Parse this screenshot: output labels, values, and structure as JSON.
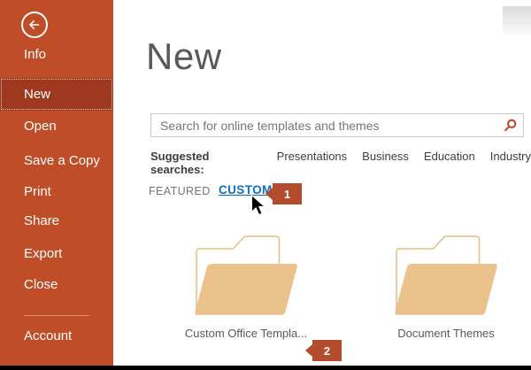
{
  "sidebar": {
    "items": [
      {
        "label": "Info",
        "selected": false
      },
      {
        "label": "New",
        "selected": true
      },
      {
        "label": "Open",
        "selected": false
      },
      {
        "label": "Save a Copy",
        "selected": false
      },
      {
        "label": "Print",
        "selected": false
      },
      {
        "label": "Share",
        "selected": false
      },
      {
        "label": "Export",
        "selected": false
      },
      {
        "label": "Close",
        "selected": false
      }
    ],
    "account_label": "Account",
    "back_icon": "back-arrow-circle"
  },
  "main": {
    "title": "New",
    "search": {
      "placeholder": "Search for online templates and themes",
      "value": "",
      "icon": "search-magnifier"
    },
    "suggested": {
      "label": "Suggested searches:",
      "links": [
        "Presentations",
        "Business",
        "Education",
        "Industry"
      ]
    },
    "tabs": [
      {
        "label": "FEATURED",
        "active": false
      },
      {
        "label": "CUSTOM",
        "active": true
      }
    ],
    "folders": [
      {
        "label": "Custom Office Templa...",
        "icon": "open-folder"
      },
      {
        "label": "Document Themes",
        "icon": "open-folder"
      }
    ]
  },
  "annotations": [
    {
      "number": "1"
    },
    {
      "number": "2"
    }
  ],
  "colors": {
    "sidebar_bg": "#BF4D28",
    "sidebar_selected_bg": "#9E381E",
    "accent_line": "#BF4D28",
    "link_blue": "#0E6FC1",
    "badge_red": "#B44B2C",
    "search_icon_red": "#C0492B",
    "folder_fill": "#ECC28C",
    "folder_outline": "#E7BE83",
    "title_gray": "#595959"
  }
}
